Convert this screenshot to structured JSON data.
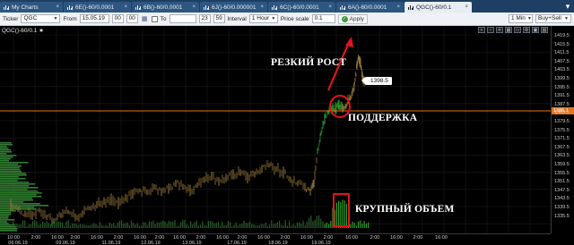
{
  "tabs": [
    {
      "label": "My Charts",
      "icon": "chart-icon",
      "active": false
    },
    {
      "label": "6E()-60/0.0001",
      "icon": "chart-icon",
      "active": false
    },
    {
      "label": "6B()-60/0.0001",
      "icon": "chart-icon",
      "active": false
    },
    {
      "label": "6J()-60/0.000001",
      "icon": "chart-icon",
      "active": false
    },
    {
      "label": "6C()-60/0.0001",
      "icon": "chart-icon",
      "active": false
    },
    {
      "label": "6A()-60/0.0001",
      "icon": "chart-icon",
      "active": false
    },
    {
      "label": "QGC()-60/0.1",
      "icon": "chart-icon",
      "active": true
    }
  ],
  "toolbar": {
    "ticker_label": "Ticker",
    "ticker_value": "QGC",
    "from_label": "From",
    "from_date": "15.05.19",
    "from_hour": "00",
    "from_minute": "00",
    "to_label": "To",
    "to_hour": "23",
    "to_minute": "59",
    "interval_label": "Interval",
    "interval_value": "1 Hour",
    "price_scale_label": "Price scale",
    "price_scale_value": "0.1",
    "apply_label": "Apply",
    "timeframe_value": "1 Min",
    "mode_value": "Buy+Sell"
  },
  "chart": {
    "title": "QGC()-60/0.1 ★",
    "current_price": "1386.1",
    "callout_price": "1398.5",
    "annotation_growth": "РЕЗКИЙ РОСТ",
    "annotation_support": "ПОДДЕРЖКА",
    "annotation_volume": "КРУПНЫЙ ОБЪЕМ",
    "colors": {
      "background": "#000000",
      "support_line": "#e3731c",
      "annotation": "#e0141b",
      "price_bars": "#9a7a3a",
      "volume_profile": "#2f7d2f"
    },
    "price_ticks": [
      "1419.5",
      "1415.5",
      "1411.5",
      "1407.5",
      "1403.5",
      "1399.5",
      "1395.5",
      "1391.5",
      "1387.5",
      "1383.5",
      "1379.5",
      "1375.5",
      "1371.5",
      "1367.5",
      "1363.5",
      "1359.5",
      "1355.5",
      "1351.5",
      "1347.5",
      "1343.5",
      "1339.5",
      "1335.5"
    ],
    "time_ticks_top": [
      "10:00",
      "2:00",
      "16:00",
      "2:00",
      "16:00",
      "2:00",
      "16:00",
      "2:00",
      "16:00",
      "2:00",
      "16:00",
      "2:00",
      "16:00",
      "2:00",
      "16:00",
      "2:00",
      "16:00",
      "2:00",
      "16:00",
      "2:00",
      "16:00"
    ],
    "time_ticks_bottom": [
      "06.06.19",
      "09.06.19",
      "11.06.19",
      "12.06.19",
      "13.06.19",
      "17.06.19",
      "18.06.19",
      "19.06.19"
    ]
  }
}
